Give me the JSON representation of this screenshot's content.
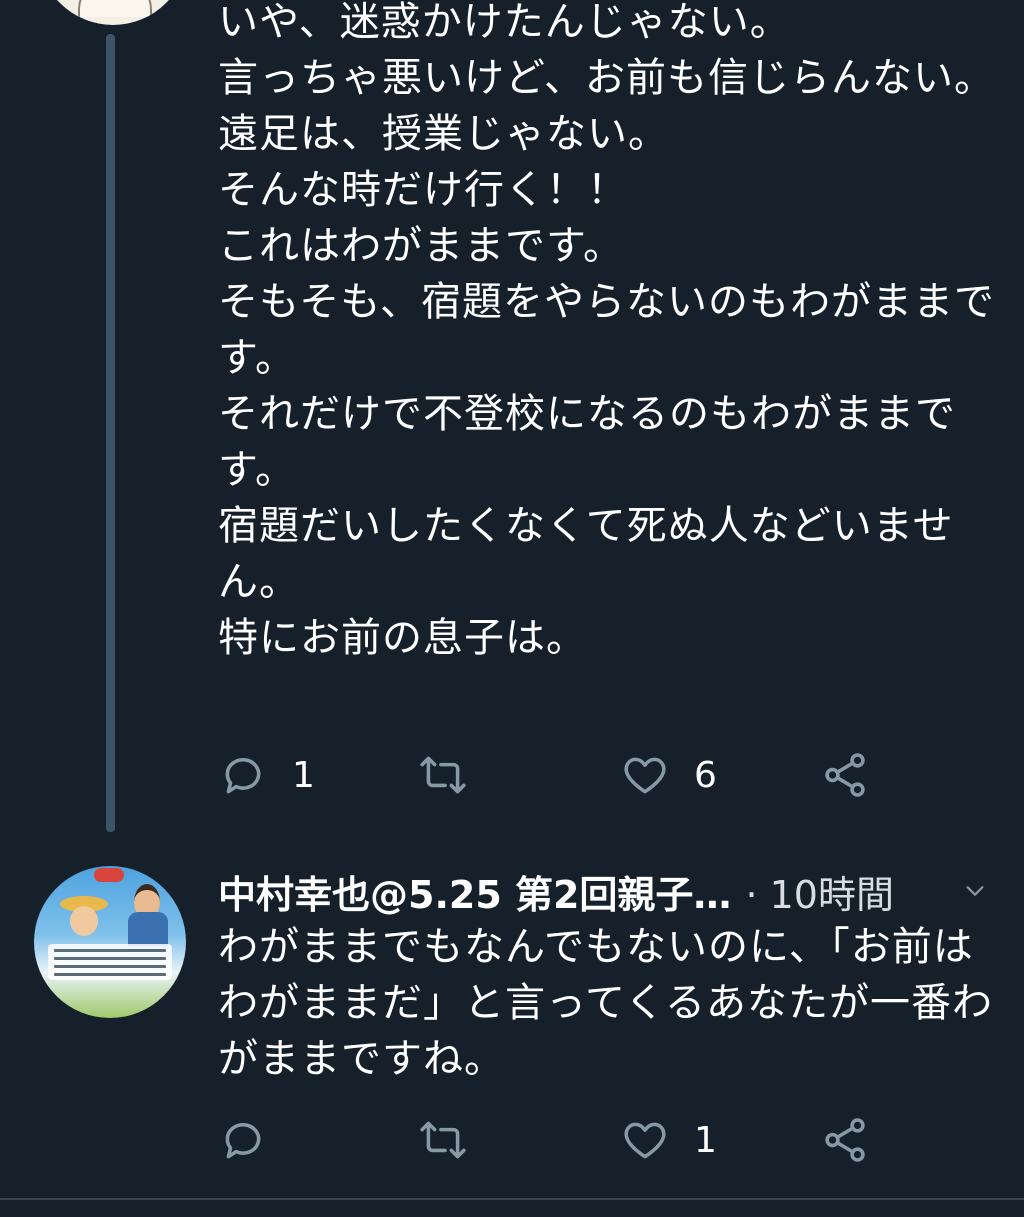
{
  "parent_tweet": {
    "text": "いや、迷惑かけたんじゃない。\n言っちゃ悪いけど、お前も信じらんない。\n遠足は、授業じゃない。\nそんな時だけ行く！！\nこれはわがままです。\nそもそも、宿題をやらないのもわがままです。\nそれだけで不登校になるのもわがままです。\n宿題だいしたくなくて死ぬ人などいません。\n特にお前の息子は。",
    "reply_count": "1",
    "like_count": "6"
  },
  "reply_tweet": {
    "author_name": "中村幸也@5.25 第2回親子…",
    "timestamp": "· 10時間",
    "text": "わがままでもなんでもないのに、「お前はわがままだ」と言ってくるあなたが一番わがままですね。",
    "like_count": "1"
  },
  "icons": {
    "reply": "comment-bubble-icon",
    "retweet": "retweet-icon",
    "like": "heart-icon",
    "share": "share-icon",
    "menu": "chevron-down-icon"
  },
  "colors": {
    "background": "#15202b",
    "thread_line": "#3d5466",
    "icon": "#8899a6",
    "text": "#ffffff"
  }
}
